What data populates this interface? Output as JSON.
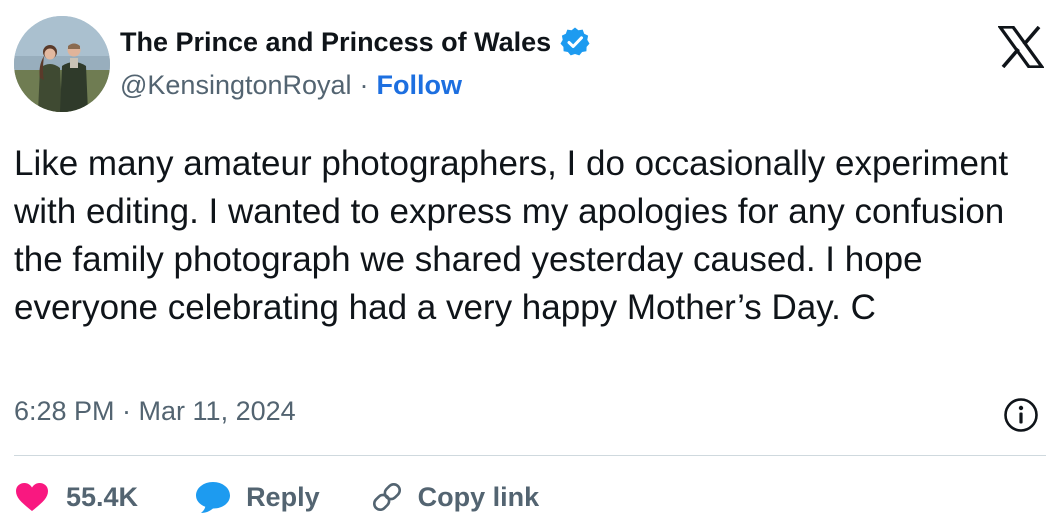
{
  "header": {
    "display_name": "The Prince and Princess of Wales",
    "handle": "@KensingtonRoyal",
    "separator": "·",
    "follow_label": "Follow",
    "verified_icon": "verified-badge-icon",
    "platform_icon": "x-logo-icon"
  },
  "tweet": {
    "text": "Like many amateur photographers, I do occasionally experiment with editing. I wanted to express my apologies for any confusion the family photograph we shared yesterday caused. I hope everyone celebrating had a very happy Mother’s Day. C",
    "timestamp": "6:28 PM · Mar 11, 2024"
  },
  "actions": {
    "like_count": "55.4K",
    "reply_label": "Reply",
    "copy_link_label": "Copy link"
  },
  "colors": {
    "text": "#0f1419",
    "secondary": "#536471",
    "link": "#1d6fe0",
    "verified": "#1d9bf0",
    "heart": "#f91880",
    "reply_bubble": "#1d9bf0",
    "divider": "#cfd9de"
  }
}
